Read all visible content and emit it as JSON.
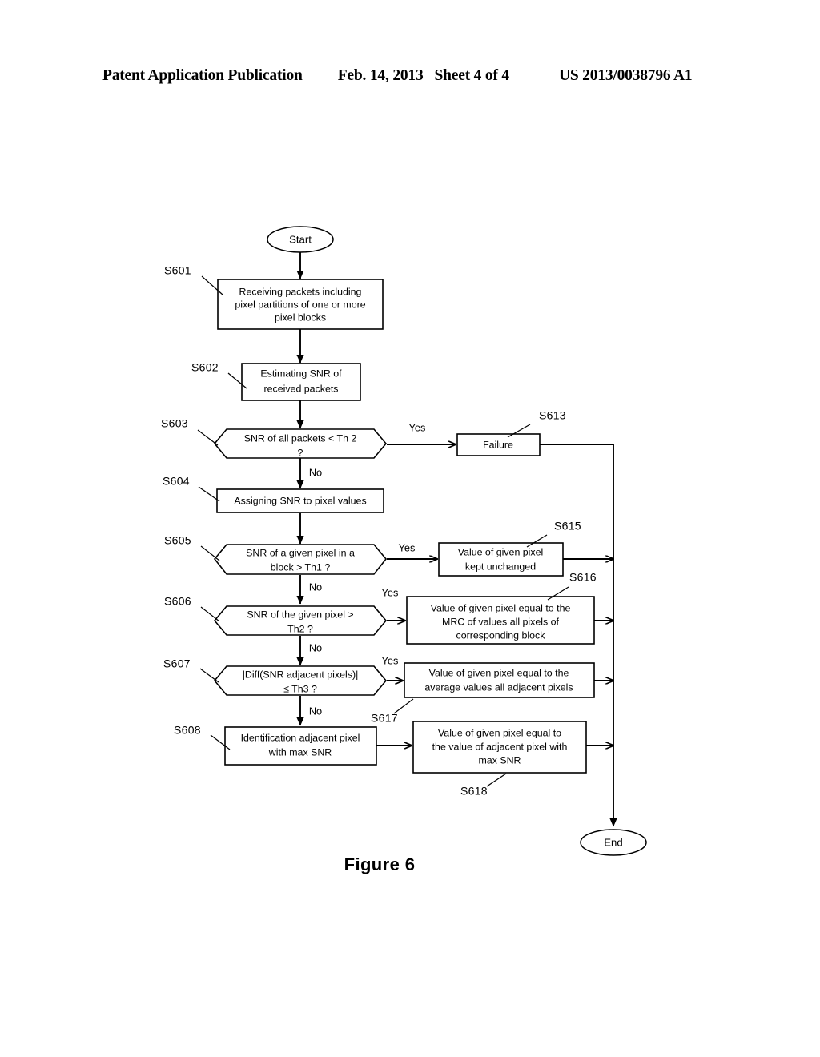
{
  "header": {
    "publication": "Patent Application Publication",
    "date": "Feb. 14, 2013",
    "sheet": "Sheet 4 of 4",
    "number": "US 2013/0038796 A1"
  },
  "figure": {
    "caption": "Figure 6"
  },
  "chart_data": {
    "type": "diagram",
    "title": "Figure 6",
    "diagram_kind": "flowchart",
    "nodes": [
      {
        "id": "start",
        "ref": "",
        "shape": "terminator",
        "label": "Start"
      },
      {
        "id": "s601",
        "ref": "S601",
        "shape": "process",
        "label": "Receiving packets including pixel partitions of one or more pixel blocks"
      },
      {
        "id": "s602",
        "ref": "S602",
        "shape": "process",
        "label": "Estimating SNR of received packets"
      },
      {
        "id": "s603",
        "ref": "S603",
        "shape": "decision",
        "label": "SNR of all packets < Th 2 ?"
      },
      {
        "id": "s613",
        "ref": "S613",
        "shape": "process",
        "label": "Failure"
      },
      {
        "id": "s604",
        "ref": "S604",
        "shape": "process",
        "label": "Assigning SNR to pixel values"
      },
      {
        "id": "s605",
        "ref": "S605",
        "shape": "decision",
        "label": "SNR of a given pixel in a block > Th1 ?"
      },
      {
        "id": "s615",
        "ref": "S615",
        "shape": "process",
        "label": "Value of given pixel kept unchanged"
      },
      {
        "id": "s606",
        "ref": "S606",
        "shape": "decision",
        "label": "SNR of the given pixel > Th2 ?"
      },
      {
        "id": "s616",
        "ref": "S616",
        "shape": "process",
        "label": "Value of given pixel equal to the MRC of values all pixels of corresponding block"
      },
      {
        "id": "s607",
        "ref": "S607",
        "shape": "decision",
        "label": "|Diff(SNR adjacent pixels)| ≤ Th3 ?"
      },
      {
        "id": "s617",
        "ref": "S617",
        "shape": "process",
        "label": "Value of given pixel equal to the average values all adjacent pixels"
      },
      {
        "id": "s608",
        "ref": "S608",
        "shape": "process",
        "label": "Identification adjacent pixel with max SNR"
      },
      {
        "id": "s618",
        "ref": "S618",
        "shape": "process",
        "label": "Value of given pixel equal to the value of adjacent pixel with max SNR"
      },
      {
        "id": "end",
        "ref": "",
        "shape": "terminator",
        "label": "End"
      }
    ],
    "edges": [
      {
        "from": "start",
        "to": "s601",
        "label": ""
      },
      {
        "from": "s601",
        "to": "s602",
        "label": ""
      },
      {
        "from": "s602",
        "to": "s603",
        "label": ""
      },
      {
        "from": "s603",
        "to": "s613",
        "label": "Yes"
      },
      {
        "from": "s603",
        "to": "s604",
        "label": "No"
      },
      {
        "from": "s604",
        "to": "s605",
        "label": ""
      },
      {
        "from": "s605",
        "to": "s615",
        "label": "Yes"
      },
      {
        "from": "s605",
        "to": "s606",
        "label": "No"
      },
      {
        "from": "s606",
        "to": "s616",
        "label": "Yes"
      },
      {
        "from": "s606",
        "to": "s607",
        "label": "No"
      },
      {
        "from": "s607",
        "to": "s617",
        "label": "Yes"
      },
      {
        "from": "s607",
        "to": "s608",
        "label": "No"
      },
      {
        "from": "s608",
        "to": "s618",
        "label": ""
      },
      {
        "from": "s613",
        "to": "end",
        "label": ""
      },
      {
        "from": "s615",
        "to": "end",
        "label": ""
      },
      {
        "from": "s616",
        "to": "end",
        "label": ""
      },
      {
        "from": "s617",
        "to": "end",
        "label": ""
      },
      {
        "from": "s618",
        "to": "end",
        "label": ""
      }
    ]
  },
  "nodes": {
    "start": {
      "label": "Start"
    },
    "end": {
      "label": "End"
    },
    "s601": {
      "ref": "S601",
      "line1": "Receiving packets including",
      "line2": "pixel partitions of one or more",
      "line3": "pixel blocks"
    },
    "s602": {
      "ref": "S602",
      "line1": "Estimating SNR of",
      "line2": "received packets"
    },
    "s603": {
      "ref": "S603",
      "line1": "SNR of all packets < Th 2",
      "line2": "?"
    },
    "s613": {
      "ref": "S613",
      "line1": "Failure"
    },
    "s604": {
      "ref": "S604",
      "line1": "Assigning SNR to pixel values"
    },
    "s605": {
      "ref": "S605",
      "line1": "SNR of a given pixel in a",
      "line2": "block > Th1 ?"
    },
    "s615": {
      "ref": "S615",
      "line1": "Value of given pixel",
      "line2": "kept unchanged"
    },
    "s606": {
      "ref": "S606",
      "line1": "SNR of the given pixel >",
      "line2": "Th2 ?"
    },
    "s616": {
      "ref": "S616",
      "line1": "Value of given pixel equal to the",
      "line2": "MRC of values all pixels of",
      "line3": "corresponding block"
    },
    "s607": {
      "ref": "S607",
      "line1": "|Diff(SNR adjacent pixels)|",
      "line2": "≤ Th3  ?"
    },
    "s617": {
      "ref": "S617",
      "line1": "Value of given pixel equal to the",
      "line2": "average values all adjacent pixels"
    },
    "s608": {
      "ref": "S608",
      "line1": "Identification adjacent pixel",
      "line2": "with max SNR"
    },
    "s618": {
      "ref": "S618",
      "line1": "Value of given pixel equal to",
      "line2": "the value of adjacent pixel with",
      "line3": "max SNR"
    }
  },
  "branch_labels": {
    "yes_s603": "Yes",
    "no_s603": "No",
    "yes_s605": "Yes",
    "no_s605": "No",
    "yes_s606": "Yes",
    "no_s606": "No",
    "yes_s607": "Yes",
    "no_s607": "No"
  }
}
